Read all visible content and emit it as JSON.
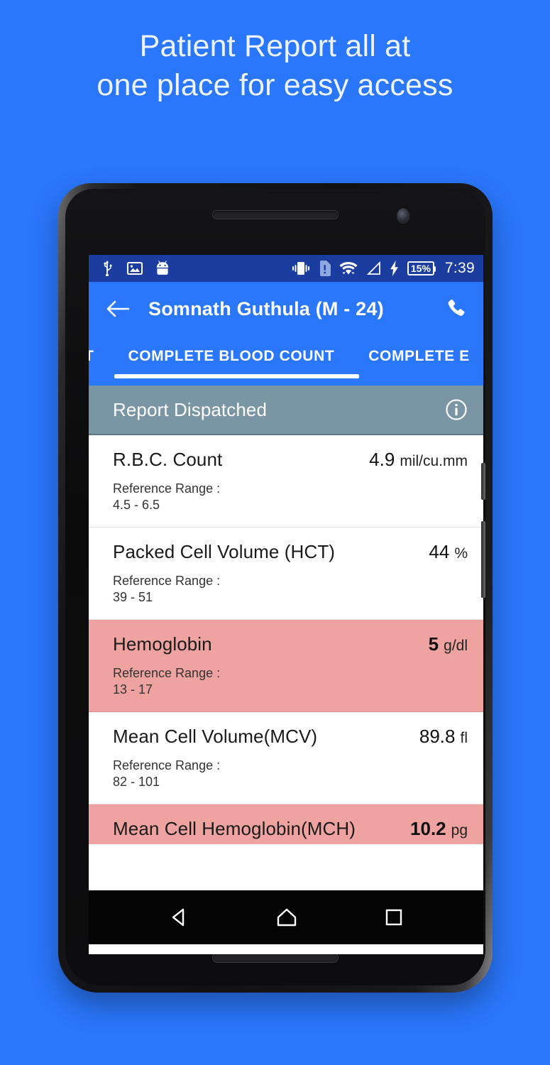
{
  "headline": {
    "line1": "Patient Report all at",
    "line2": "one place for easy access"
  },
  "colors": {
    "background_blue": "#2a77fc",
    "statusbar_blue": "#1b3da0",
    "appbar_blue": "#2a77fc",
    "dispatch_gray": "#7a95a4",
    "abnormal_pink": "#efa3a0",
    "row_white": "#ffffff"
  },
  "statusbar": {
    "time": "7:39",
    "battery_percent": "15%",
    "icons_left": [
      "usb-icon",
      "image-icon",
      "android-robot-icon"
    ],
    "icons_right": [
      "vibrate-icon",
      "sim-card-alert-icon",
      "wifi-icon",
      "signal-icon",
      "charging-bolt-icon",
      "battery-icon"
    ]
  },
  "appbar": {
    "back_icon": "back-arrow-icon",
    "title": "Somnath Guthula (M - 24)",
    "call_icon": "phone-icon"
  },
  "tabs": [
    {
      "label": "T",
      "active": false,
      "clipped": "left"
    },
    {
      "label": "COMPLETE BLOOD COUNT",
      "active": true,
      "clipped": "none"
    },
    {
      "label": "COMPLETE E",
      "active": false,
      "clipped": "right"
    }
  ],
  "dispatch": {
    "label": "Report Dispatched",
    "info_icon": "info-circle-icon"
  },
  "reference_label": "Reference Range :",
  "results": [
    {
      "name": "R.B.C. Count",
      "value": "4.9",
      "unit": "mil/cu.mm",
      "reference_label": "Reference Range :",
      "reference_range": "4.5 - 6.5",
      "abnormal": false
    },
    {
      "name": "Packed Cell Volume (HCT)",
      "value": "44",
      "unit": "%",
      "reference_label": "Reference Range :",
      "reference_range": "39 - 51",
      "abnormal": false
    },
    {
      "name": "Hemoglobin",
      "value": "5",
      "unit": "g/dl",
      "reference_label": "Reference Range :",
      "reference_range": "13 - 17",
      "abnormal": true
    },
    {
      "name": "Mean Cell Volume(MCV)",
      "value": "89.8",
      "unit": "fl",
      "reference_label": "Reference Range :",
      "reference_range": "82 - 101",
      "abnormal": false
    },
    {
      "name": "Mean Cell Hemoglobin(MCH)",
      "value": "10.2",
      "unit": "pg",
      "reference_label": "",
      "reference_range": "",
      "abnormal": true
    }
  ],
  "navbar": {
    "back": "nav-back-icon",
    "home": "nav-home-icon",
    "recents": "nav-recents-icon"
  }
}
